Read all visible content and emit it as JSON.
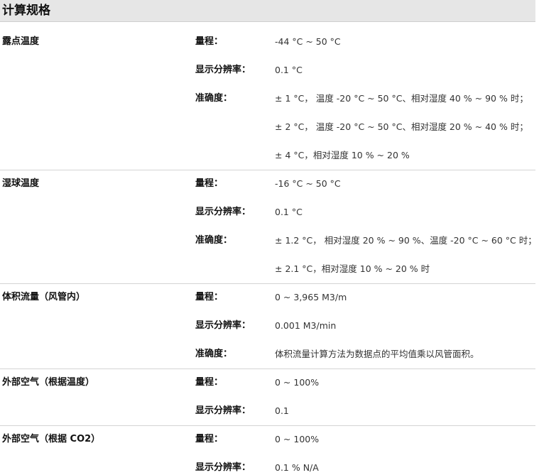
{
  "section_title": "计算规格",
  "sections": [
    {
      "category": "露点温度",
      "rows": [
        {
          "label": "量程：",
          "value": " -44 °C ~ 50 °C"
        },
        {
          "label": "显示分辨率：",
          "value": "0.1 °C"
        },
        {
          "label": "准确度：",
          "value": "± 1 °C，  温度 -20 °C ~ 50 °C、相对湿度 40 % ~ 90 % 时；"
        },
        {
          "label": "",
          "value": "± 2 °C，  温度 -20 °C ~ 50 °C、相对湿度 20 % ~ 40 % 时；"
        },
        {
          "label": "",
          "value": "± 4 °C，相对湿度 10 % ~ 20 %"
        }
      ]
    },
    {
      "category": "湿球温度",
      "rows": [
        {
          "label": "量程：",
          "value": " -16 °C ~ 50 °C"
        },
        {
          "label": "显示分辨率：",
          "value": "0.1 °C"
        },
        {
          "label": "准确度：",
          "value": "± 1.2 °C，  相对湿度 20 % ~ 90 %、温度 -20 °C ~ 60 °C 时；"
        },
        {
          "label": "",
          "value": "± 2.1 °C，相对湿度 10 % ~ 20 % 时"
        }
      ]
    },
    {
      "category": "体积流量（风管内）",
      "rows": [
        {
          "label": "量程：",
          "value": " 0 ~ 3,965 M3/m"
        },
        {
          "label": "显示分辨率：",
          "value": "0.001 M3/min"
        },
        {
          "label": "准确度：",
          "value": "体积流量计算方法为数据点的平均值乘以风管面积。"
        }
      ]
    },
    {
      "category": "外部空气（根据温度）",
      "rows": [
        {
          "label": "量程：",
          "value": " 0 ~ 100%"
        },
        {
          "label": "显示分辨率：",
          "value": "0.1"
        }
      ]
    },
    {
      "category": "外部空气（根据 CO2）",
      "rows": [
        {
          "label": "量程：",
          "value": " 0 ~ 100%"
        },
        {
          "label": "显示分辨率：",
          "value": "0.1 % N/A"
        }
      ]
    }
  ]
}
